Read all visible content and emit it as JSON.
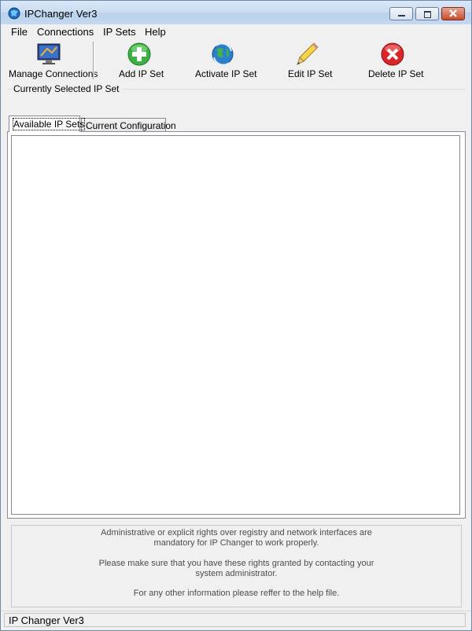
{
  "window": {
    "title": "IPChanger Ver3"
  },
  "menu": [
    {
      "label": "File"
    },
    {
      "label": "Connections"
    },
    {
      "label": "IP Sets"
    },
    {
      "label": "Help"
    }
  ],
  "toolbar": {
    "manage": {
      "label": "Manage Connections",
      "icon": "network-monitor-icon"
    },
    "add": {
      "label": "Add IP Set",
      "icon": "plus-circle-icon"
    },
    "activate": {
      "label": "Activate IP Set",
      "icon": "globe-refresh-icon"
    },
    "edit": {
      "label": "Edit IP Set",
      "icon": "pencil-icon"
    },
    "delete": {
      "label": "Delete IP Set",
      "icon": "delete-circle-icon"
    }
  },
  "selected_group": {
    "label": "Currently Selected IP Set"
  },
  "tabs": [
    {
      "label": "Available IP Sets",
      "active": true
    },
    {
      "label": "Current Configuration",
      "active": false
    }
  ],
  "info": {
    "p1_line1": "Administrative or explicit rights over registry and network interfaces are",
    "p1_line2": "mandatory for IP Changer to work properly.",
    "p2_line1": "Please make sure that you have these rights granted by contacting your",
    "p2_line2": "system administrator.",
    "p3_line1": "For any other information please reffer to the help file."
  },
  "statusbar": {
    "text": "IP Changer Ver3"
  },
  "colors": {
    "add": "#3cb043",
    "delete": "#d8262a",
    "globe": "#2a7fd0"
  }
}
